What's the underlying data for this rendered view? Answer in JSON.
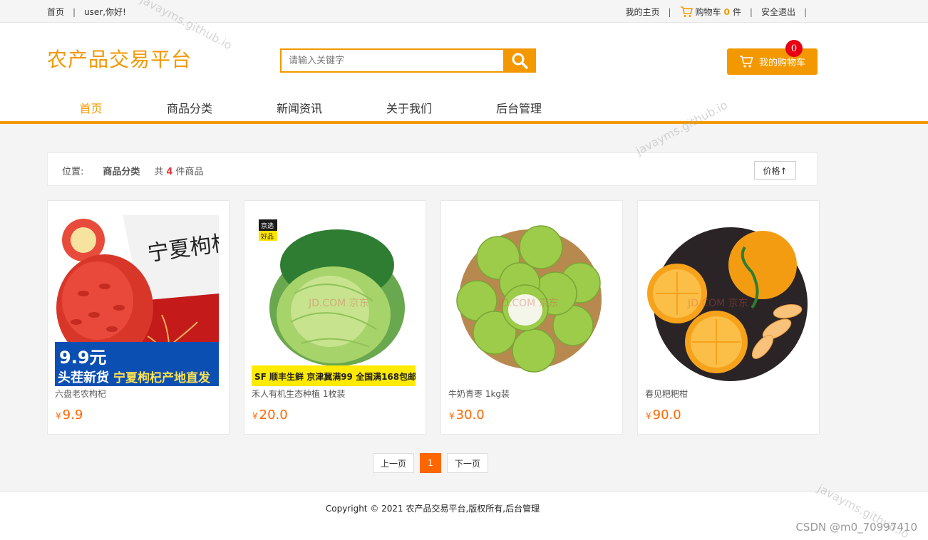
{
  "topbar": {
    "home": "首页",
    "greeting": "user,你好!",
    "my_home": "我的主页",
    "cart_prefix": "购物车",
    "cart_count": "0",
    "cart_suffix": "件",
    "logout": "安全退出"
  },
  "header": {
    "logo": "农产品交易平台",
    "search_placeholder": "请输入关键字",
    "mycart_label": "我的购物车",
    "mycart_badge": "0"
  },
  "nav": [
    {
      "label": "首页",
      "active": true
    },
    {
      "label": "商品分类"
    },
    {
      "label": "新闻资讯"
    },
    {
      "label": "关于我们"
    },
    {
      "label": "后台管理"
    }
  ],
  "location": {
    "label": "位置:",
    "category": "商品分类",
    "count_prefix": "共",
    "count": "4",
    "count_suffix": "件商品",
    "sort_label": "价格↑"
  },
  "products": [
    {
      "name": "六盘老农枸杞",
      "currency": "¥",
      "price": "9.9",
      "image_icon": "goji-berry-image"
    },
    {
      "name": "禾人有机生态种植 1枚装",
      "currency": "¥",
      "price": "20.0",
      "image_icon": "cabbage-image"
    },
    {
      "name": "牛奶青枣 1kg装",
      "currency": "¥",
      "price": "30.0",
      "image_icon": "green-jujube-image"
    },
    {
      "name": "春见粑粑柑",
      "currency": "¥",
      "price": "90.0",
      "image_icon": "orange-image"
    }
  ],
  "product_image_text": {
    "goji_brand": "宁夏枸杞",
    "goji_price": "9.9元",
    "goji_tag": "头茬新货",
    "goji_slogan": "宁夏枸杞产地直发",
    "cabbage_tag1": "京选",
    "cabbage_tag2": "好品",
    "cabbage_banner": "SF 顺丰生鲜  京津冀满99  全国满168包邮",
    "jd_watermark": "JD.COM 京东"
  },
  "pagination": {
    "prev": "上一页",
    "current": "1",
    "next": "下一页"
  },
  "footer": {
    "copyright": "Copyright © 2021 农产品交易平台,版权所有,后台管理",
    "csdn": "CSDN @m0_70997410"
  },
  "watermark": "javayms.github.io",
  "colors": {
    "accent": "#f39800",
    "price": "#ff6600",
    "badge": "#e60012"
  }
}
